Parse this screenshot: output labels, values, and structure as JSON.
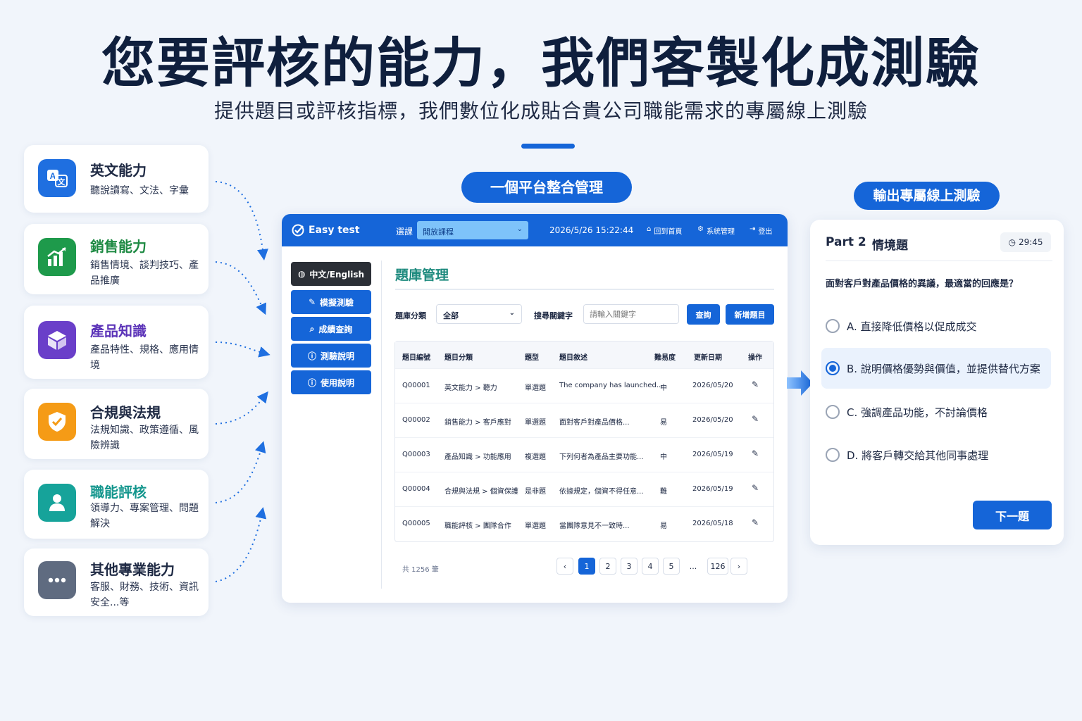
{
  "hero": {
    "title": "您要評核的能力，我們客製化成測驗",
    "subtitle": "提供題目或評核指標，我們數位化成貼合貴公司職能需求的專屬線上測驗"
  },
  "skills": [
    {
      "title": "英文能力",
      "desc": "聽說讀寫、文法、字彙",
      "icon": "translate-icon",
      "color": "#1f6fe0",
      "title_color": "#1f2a44"
    },
    {
      "title": "銷售能力",
      "desc": "銷售情境、談判技巧、產品推廣",
      "icon": "chart-growth-icon",
      "color": "#1e9a4b",
      "title_color": "#1e8a43"
    },
    {
      "title": "產品知識",
      "desc": "產品特性、規格、應用情境",
      "icon": "cube-icon",
      "color": "#6a3fc9",
      "title_color": "#5b33b8"
    },
    {
      "title": "合規與法規",
      "desc": "法規知識、政策遵循、風險辨識",
      "icon": "shield-icon",
      "color": "#f59b16",
      "title_color": "#1f2a44"
    },
    {
      "title": "職能評核",
      "desc": "領導力、專案管理、問題解決",
      "icon": "user-icon",
      "color": "#16a39a",
      "title_color": "#13968d"
    },
    {
      "title": "其他專業能力",
      "desc": "客服、財務、技術、資訊安全...等",
      "icon": "more-icon",
      "color": "#5f6b80",
      "title_color": "#1f2a44"
    }
  ],
  "pills": {
    "platform": "一個平台整合管理",
    "output": "輸出專屬線上測驗"
  },
  "admin": {
    "brand": "Easy test",
    "course_label": "選課",
    "course_value": "開放課程",
    "datetime": "2026/5/26 15:22:44",
    "nav_home": "回到首頁",
    "nav_system": "系統管理",
    "nav_logout": "登出",
    "lang_button": "中文/English",
    "side_buttons": [
      "模擬測驗",
      "成績查詢",
      "測驗說明",
      "使用說明"
    ],
    "page_title": "題庫管理",
    "filter_label": "題庫分類",
    "filter_value": "全部",
    "search_label": "搜尋關鍵字",
    "search_placeholder": "請輸入關鍵字",
    "query_button": "查詢",
    "add_button": "新增題目",
    "columns": [
      "題目編號",
      "題目分類",
      "題型",
      "題目敘述",
      "難易度",
      "更新日期",
      "操作"
    ],
    "rows": [
      [
        "Q00001",
        "英文能力 > 聽力",
        "單選題",
        "The company has launched...",
        "中",
        "2026/05/20"
      ],
      [
        "Q00002",
        "銷售能力 > 客戶應對",
        "單選題",
        "面對客戶對產品價格...",
        "易",
        "2026/05/20"
      ],
      [
        "Q00003",
        "產品知識 > 功能應用",
        "複選題",
        "下列何者為產品主要功能...",
        "中",
        "2026/05/19"
      ],
      [
        "Q00004",
        "合規與法規 > 個資保護",
        "是非題",
        "依據規定，個資不得任意...",
        "難",
        "2026/05/19"
      ],
      [
        "Q00005",
        "職能評核 > 團隊合作",
        "單選題",
        "當團隊意見不一致時...",
        "易",
        "2026/05/18"
      ]
    ],
    "total": "共 1256 筆",
    "pages": [
      "1",
      "2",
      "3",
      "4",
      "5",
      "...",
      "126"
    ],
    "current_page": "1"
  },
  "quiz": {
    "part": "Part 2",
    "section": "情境題",
    "timer": "29:45",
    "question": "面對客戶對產品價格的異議，最適當的回應是？",
    "options": [
      "A. 直接降低價格以促成成交",
      "B. 說明價格優勢與價值，並提供替代方案",
      "C. 強調產品功能，不討論價格",
      "D. 將客戶轉交給其他同事處理"
    ],
    "selected_index": 1,
    "next_button": "下一題"
  },
  "colors": {
    "primary": "#1565d8",
    "background": "#f1f5fb",
    "heading": "#0f1f3d"
  }
}
